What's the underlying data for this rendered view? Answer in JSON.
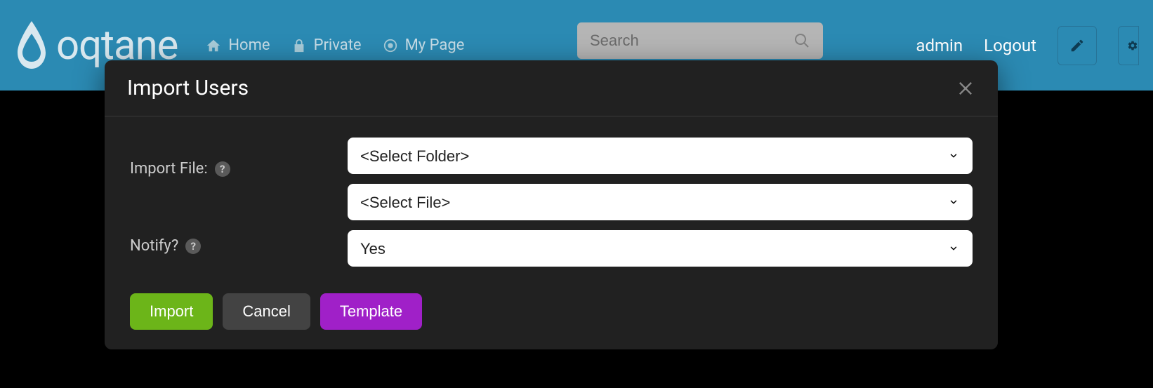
{
  "header": {
    "logo_text": "oqtane",
    "nav": [
      {
        "label": "Home",
        "icon": "home"
      },
      {
        "label": "Private",
        "icon": "lock"
      },
      {
        "label": "My Page",
        "icon": "target"
      }
    ],
    "search_placeholder": "Search",
    "user": "admin",
    "logout": "Logout"
  },
  "modal": {
    "title": "Import Users",
    "fields": {
      "import_file_label": "Import File:",
      "folder_select": "<Select Folder>",
      "file_select": "<Select File>",
      "notify_label": "Notify?",
      "notify_value": "Yes"
    },
    "buttons": {
      "import": "Import",
      "cancel": "Cancel",
      "template": "Template"
    }
  }
}
